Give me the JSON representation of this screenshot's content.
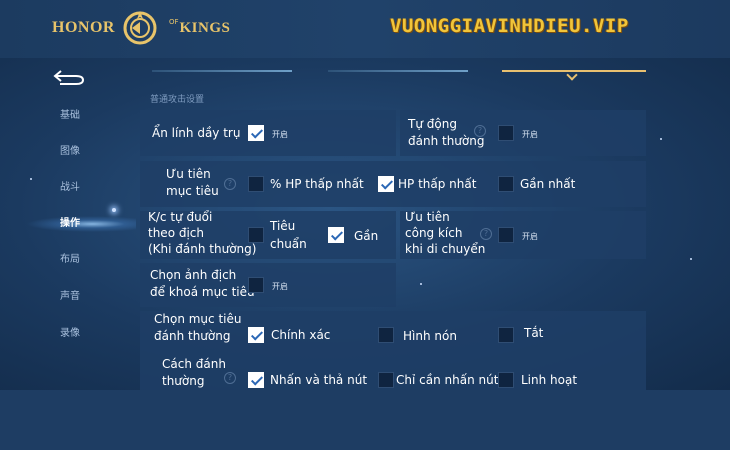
{
  "header": {
    "logo": {
      "left_text": "HONOR",
      "of_text": "OF",
      "right_text": "KINGS"
    },
    "site_name": "VUONGGIAVINHDIEU.VIP"
  },
  "sidebar": {
    "items": [
      {
        "label": "基础",
        "active": false
      },
      {
        "label": "图像",
        "active": false
      },
      {
        "label": "战斗",
        "active": false
      },
      {
        "label": "操作",
        "active": true
      },
      {
        "label": "布局",
        "active": false
      },
      {
        "label": "声音",
        "active": false
      },
      {
        "label": "录像",
        "active": false
      }
    ]
  },
  "section_title": "普通攻击设置",
  "settings": {
    "an_linh": {
      "label_line1": "Ẩn lính dầy trụ",
      "checked": true,
      "tag": "开启"
    },
    "tu_dong": {
      "label_line1": "Tự động",
      "label_line2": "đánh thường",
      "checked": false,
      "tag": "开启"
    },
    "uu_tien": {
      "label_line1": "Ưu tiên",
      "label_line2": "mục tiêu",
      "options": [
        {
          "label": "% HP thấp nhất",
          "checked": false
        },
        {
          "label": "HP thấp nhất",
          "checked": true
        },
        {
          "label": "Gần nhất",
          "checked": false
        }
      ]
    },
    "kc": {
      "label_line1": "K/c tự đuổi",
      "label_line2": "theo địch",
      "label_line3": "(Khi đánh thường)",
      "options": [
        {
          "label_line1": "Tiêu",
          "label_line2": "chuẩn",
          "checked": false
        },
        {
          "label": "Gần",
          "checked": true
        }
      ]
    },
    "uu_tien_cong": {
      "label_line1": "Ưu tiên",
      "label_line2": "công kích",
      "label_line3": "khi di chuyển",
      "checked": false,
      "tag": "开启"
    },
    "chon_anh": {
      "label_line1": "Chọn ảnh địch",
      "label_line2": "để khoá mục tiêu",
      "checked": false,
      "tag": "开启"
    },
    "chon_muc_tieu": {
      "label_line1": "Chọn mục tiêu",
      "label_line2": "đánh thường",
      "options": [
        {
          "label": "Chính xác",
          "checked": true
        },
        {
          "label": "Hình nón",
          "checked": false
        },
        {
          "label": "Tắt",
          "checked": false
        }
      ]
    },
    "cach_danh": {
      "label_line1": "Cách đánh",
      "label_line2": "thường",
      "options": [
        {
          "label": "Nhấn và thả nút",
          "checked": true
        },
        {
          "label": "Chỉ cần nhấn nút",
          "checked": false
        },
        {
          "label": "Linh hoạt",
          "checked": false
        }
      ]
    }
  },
  "colors": {
    "gold": "#e8c46a",
    "site": "#f1c53a",
    "panel": "#1e3e66",
    "check": "#2b67b5"
  }
}
